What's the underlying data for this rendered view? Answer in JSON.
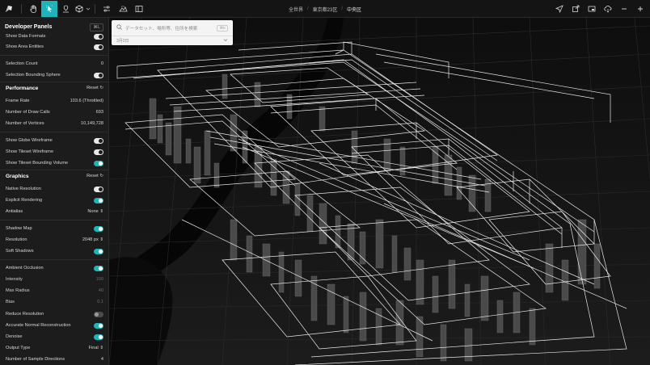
{
  "topbar": {
    "left_icons": [
      "logo-icon",
      "hand-icon",
      "select-icon",
      "pin-icon",
      "cube-icon",
      "chevron-down-icon",
      "sliders-icon",
      "terrain-icon",
      "layout-icon"
    ],
    "breadcrumb": [
      "全世界",
      "東京都23区",
      "中央区"
    ],
    "right_icons": [
      "location-arrow-icon",
      "export-icon",
      "pip-icon",
      "share-icon",
      "minus-icon",
      "plus-icon"
    ]
  },
  "search": {
    "placeholder": "データセット、場所等、住所を検索",
    "shortcut": "⌘K",
    "date": "3月2日"
  },
  "panel": {
    "title": "Developer Panels",
    "shortcut": "⌘L",
    "rows_top": [
      {
        "label": "Show Data Formats",
        "toggle": "plain"
      },
      {
        "label": "Show Area Entities",
        "toggle": "plain"
      }
    ],
    "selection_count": {
      "label": "Selection Count",
      "value": "0"
    },
    "selection_bounding": {
      "label": "Selection Bounding Sphere",
      "toggle": "plain"
    },
    "performance": {
      "title": "Performance",
      "reset": "Reset",
      "frame_rate": {
        "label": "Frame Rate",
        "value": "103.6 (Throttled)"
      },
      "draw_calls": {
        "label": "Number of Draw Calls",
        "value": "693"
      },
      "vertices": {
        "label": "Number of Vertices",
        "value": "10,149,728"
      }
    },
    "wireframe": [
      {
        "label": "Show Globe Wireframe",
        "toggle": "plain"
      },
      {
        "label": "Show Tileset Wireframe",
        "toggle": "plain"
      },
      {
        "label": "Show Tileset Bounding Volume",
        "toggle": "on"
      }
    ],
    "graphics": {
      "title": "Graphics",
      "reset": "Reset",
      "native_resolution": {
        "label": "Native Resolution",
        "toggle": "plain"
      },
      "explicit_rendering": {
        "label": "Explicit Rendering",
        "toggle": "on"
      },
      "antialias": {
        "label": "Antialias",
        "value": "None"
      }
    },
    "shadow": {
      "shadow_map": {
        "label": "Shadow Map",
        "toggle": "on"
      },
      "resolution": {
        "label": "Resolution",
        "value": "2048 px"
      },
      "soft_shadows": {
        "label": "Soft Shadows",
        "toggle": "on"
      }
    },
    "ao": {
      "ambient_occlusion": {
        "label": "Ambient Occlusion",
        "toggle": "on"
      },
      "intensity": {
        "label": "Intensity",
        "value": "100"
      },
      "max_radius": {
        "label": "Max Radius",
        "value": "40"
      },
      "bias": {
        "label": "Bias",
        "value": "0.1"
      },
      "reduce_resolution": {
        "label": "Reduce Resolution",
        "toggle": "off"
      },
      "accurate_normal": {
        "label": "Accurate Normal Reconstruction",
        "toggle": "on"
      },
      "denoise": {
        "label": "Denoise",
        "toggle": "on"
      },
      "output_type": {
        "label": "Output Type",
        "value": "Final"
      },
      "sample_directions": {
        "label": "Number of Sample Directions",
        "value": "4"
      }
    }
  },
  "colors": {
    "accent": "#1fb3ba",
    "panel_bg": "#1c1c1c",
    "map_bg": "#141414",
    "wire": "#ffffff"
  }
}
